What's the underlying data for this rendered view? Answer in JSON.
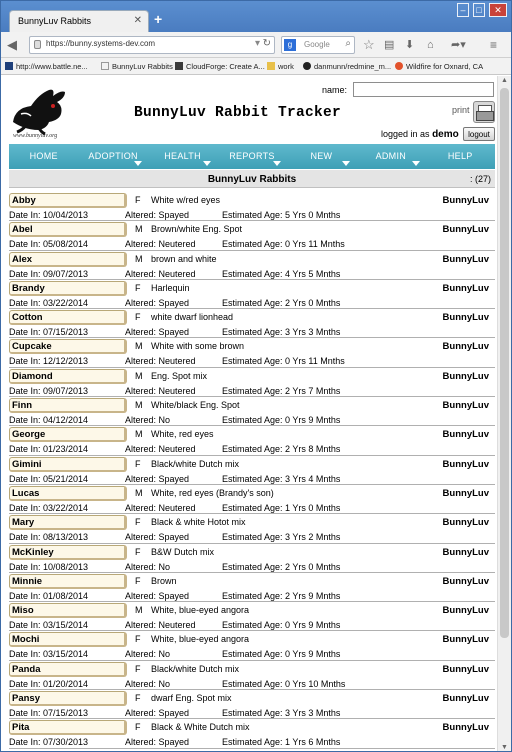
{
  "browser": {
    "tab_title": "BunnyLuv Rabbits",
    "url": "https://bunny.systems-dev.com",
    "search_placeholder": "Google",
    "bookmarks": [
      {
        "label": "http://www.battle.ne...",
        "icon": "battlenet-icon"
      },
      {
        "label": "BunnyLuv Rabbits",
        "icon": "page-icon"
      },
      {
        "label": "CloudForge: Create A...",
        "icon": "cloudforge-icon"
      },
      {
        "label": "work",
        "icon": "folder-icon"
      },
      {
        "label": "danmunn/redmine_m...",
        "icon": "github-icon"
      },
      {
        "label": "Wildfire for Oxnard, CA",
        "icon": "wildfire-icon"
      }
    ]
  },
  "header": {
    "logo_caption": "www.bunnyluv.org",
    "app_title": "BunnyLuv Rabbit Tracker",
    "name_label": "name:",
    "name_value": "",
    "print_label": "print",
    "logged_in_prefix": "logged in as",
    "username": "demo",
    "logout_label": "logout"
  },
  "menu": [
    {
      "label": "HOME",
      "dropdown": false
    },
    {
      "label": "ADOPTION",
      "dropdown": true
    },
    {
      "label": "HEALTH",
      "dropdown": true
    },
    {
      "label": "REPORTS",
      "dropdown": true
    },
    {
      "label": "NEW",
      "dropdown": true
    },
    {
      "label": "ADMIN",
      "dropdown": true
    },
    {
      "label": "HELP",
      "dropdown": false
    }
  ],
  "list": {
    "title": "BunnyLuv Rabbits",
    "count": ": (27)",
    "rabbits": [
      {
        "name": "Abby",
        "sex": "F",
        "desc": "White w/red eyes",
        "owner": "BunnyLuv",
        "date_in": "Date In: 10/04/2013",
        "altered": "Altered: Spayed",
        "age": "Estimated Age: 5 Yrs 0 Mnths"
      },
      {
        "name": "Abel",
        "sex": "M",
        "desc": "Brown/white Eng. Spot",
        "owner": "BunnyLuv",
        "date_in": "Date In: 05/08/2014",
        "altered": "Altered: Neutered",
        "age": "Estimated Age: 0 Yrs 11 Mnths"
      },
      {
        "name": "Alex",
        "sex": "M",
        "desc": "brown and white",
        "owner": "BunnyLuv",
        "date_in": "Date In: 09/07/2013",
        "altered": "Altered: Neutered",
        "age": "Estimated Age: 4 Yrs 5 Mnths"
      },
      {
        "name": "Brandy",
        "sex": "F",
        "desc": "Harlequin",
        "owner": "BunnyLuv",
        "date_in": "Date In: 03/22/2014",
        "altered": "Altered: Spayed",
        "age": "Estimated Age: 2 Yrs 0 Mnths"
      },
      {
        "name": "Cotton",
        "sex": "F",
        "desc": "white dwarf lionhead",
        "owner": "BunnyLuv",
        "date_in": "Date In: 07/15/2013",
        "altered": "Altered: Spayed",
        "age": "Estimated Age: 3 Yrs 3 Mnths"
      },
      {
        "name": "Cupcake",
        "sex": "M",
        "desc": "White with some brown",
        "owner": "BunnyLuv",
        "date_in": "Date In: 12/12/2013",
        "altered": "Altered: Neutered",
        "age": "Estimated Age: 0 Yrs 11 Mnths"
      },
      {
        "name": "Diamond",
        "sex": "M",
        "desc": "Eng. Spot mix",
        "owner": "BunnyLuv",
        "date_in": "Date In: 09/07/2013",
        "altered": "Altered: Neutered",
        "age": "Estimated Age: 2 Yrs 7 Mnths"
      },
      {
        "name": "Finn",
        "sex": "M",
        "desc": "White/black Eng. Spot",
        "owner": "BunnyLuv",
        "date_in": "Date In: 04/12/2014",
        "altered": "Altered: No",
        "age": "Estimated Age: 0 Yrs 9 Mnths"
      },
      {
        "name": "George",
        "sex": "M",
        "desc": "White, red eyes",
        "owner": "BunnyLuv",
        "date_in": "Date In: 01/23/2014",
        "altered": "Altered: Neutered",
        "age": "Estimated Age: 2 Yrs 8 Mnths"
      },
      {
        "name": "Gimini",
        "sex": "F",
        "desc": "Black/white Dutch mix",
        "owner": "BunnyLuv",
        "date_in": "Date In: 05/21/2014",
        "altered": "Altered: Spayed",
        "age": "Estimated Age: 3 Yrs 4 Mnths"
      },
      {
        "name": "Lucas",
        "sex": "M",
        "desc": "White, red eyes (Brandy's son)",
        "owner": "BunnyLuv",
        "date_in": "Date In: 03/22/2014",
        "altered": "Altered: Neutered",
        "age": "Estimated Age: 1 Yrs 0 Mnths"
      },
      {
        "name": "Mary",
        "sex": "F",
        "desc": "Black & white Hotot mix",
        "owner": "BunnyLuv",
        "date_in": "Date In: 08/13/2013",
        "altered": "Altered: Spayed",
        "age": "Estimated Age: 3 Yrs 2 Mnths"
      },
      {
        "name": "McKinley",
        "sex": "F",
        "desc": "B&W Dutch mix",
        "owner": "BunnyLuv",
        "date_in": "Date In: 10/08/2013",
        "altered": "Altered: No",
        "age": "Estimated Age: 2 Yrs 0 Mnths"
      },
      {
        "name": "Minnie",
        "sex": "F",
        "desc": "Brown",
        "owner": "BunnyLuv",
        "date_in": "Date In: 01/08/2014",
        "altered": "Altered: Spayed",
        "age": "Estimated Age: 2 Yrs 9 Mnths"
      },
      {
        "name": "Miso",
        "sex": "M",
        "desc": "White, blue-eyed angora",
        "owner": "BunnyLuv",
        "date_in": "Date In: 03/15/2014",
        "altered": "Altered: Neutered",
        "age": "Estimated Age: 0 Yrs 9 Mnths"
      },
      {
        "name": "Mochi",
        "sex": "F",
        "desc": "White, blue-eyed angora",
        "owner": "BunnyLuv",
        "date_in": "Date In: 03/15/2014",
        "altered": "Altered: No",
        "age": "Estimated Age: 0 Yrs 9 Mnths"
      },
      {
        "name": "Panda",
        "sex": "F",
        "desc": "Black/white Dutch mix",
        "owner": "BunnyLuv",
        "date_in": "Date In: 01/20/2014",
        "altered": "Altered: No",
        "age": "Estimated Age: 0 Yrs 10 Mnths"
      },
      {
        "name": "Pansy",
        "sex": "F",
        "desc": "dwarf Eng. Spot mix",
        "owner": "BunnyLuv",
        "date_in": "Date In: 07/15/2013",
        "altered": "Altered: Spayed",
        "age": "Estimated Age: 3 Yrs 3 Mnths"
      },
      {
        "name": "Pita",
        "sex": "F",
        "desc": "Black & White Dutch mix",
        "owner": "BunnyLuv",
        "date_in": "Date In: 07/30/2013",
        "altered": "Altered: Spayed",
        "age": "Estimated Age: 1 Yrs 6 Mnths"
      }
    ]
  }
}
